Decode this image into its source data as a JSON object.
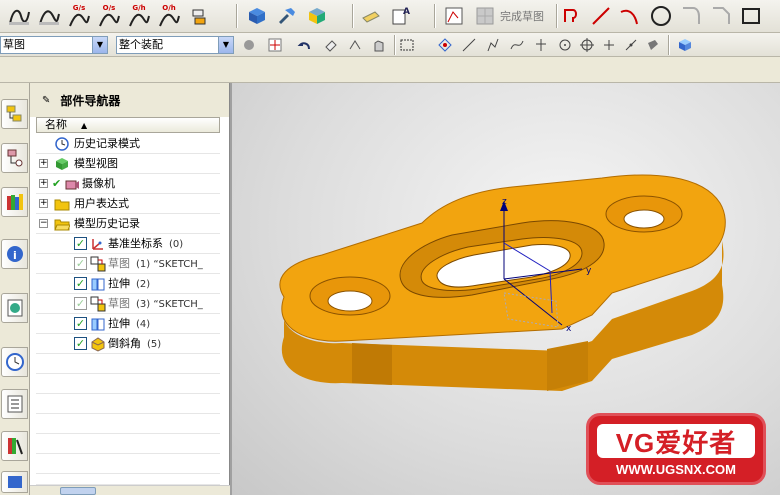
{
  "toolbar": {
    "labels": [
      "G/s",
      "O/s",
      "G/h",
      "O/h"
    ],
    "finish_sketch_label": "完成草图",
    "combo_filter": "草图",
    "combo_assembly": "整个装配"
  },
  "navigator": {
    "title": "部件导航器",
    "column_name": "名称",
    "items": [
      {
        "label": "历史记录模式",
        "arg": ""
      },
      {
        "label": "模型视图",
        "arg": ""
      },
      {
        "label": "摄像机",
        "arg": ""
      },
      {
        "label": "用户表达式",
        "arg": ""
      },
      {
        "label": "模型历史记录",
        "arg": ""
      },
      {
        "label": "基准坐标系",
        "arg": "(0)"
      },
      {
        "label": "草图",
        "arg": "(1) “SKETCH_"
      },
      {
        "label": "拉伸",
        "arg": "(2)"
      },
      {
        "label": "草图",
        "arg": "(3) “SKETCH_"
      },
      {
        "label": "拉伸",
        "arg": "(4)"
      },
      {
        "label": "倒斜角",
        "arg": "(5)"
      }
    ]
  },
  "viewport": {
    "axes": {
      "z": "z",
      "x": "x",
      "y": "y"
    },
    "part_color": "#f2a40f"
  },
  "logo": {
    "brand": "VG爱好者",
    "url": "WWW.UGSNX.COM"
  }
}
